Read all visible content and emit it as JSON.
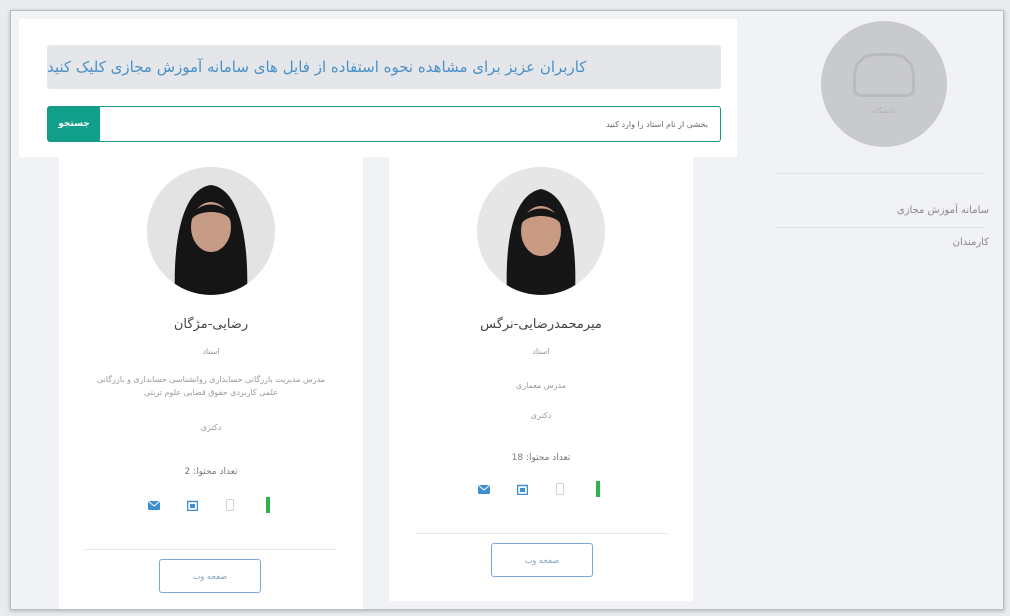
{
  "banner": {
    "text": "کاربران عزیز برای مشاهده نحوه استفاده از فایل های سامانه آموزش مجازی کلیک کنید"
  },
  "search": {
    "button_label": "جستجو",
    "placeholder": "بخشی از نام استاد را وارد کنید"
  },
  "sidebar": {
    "logo_text": "دانشگاه",
    "items": [
      {
        "label": "سامانه آموزش مجازی"
      },
      {
        "label": "کارمندان"
      }
    ]
  },
  "cards": [
    {
      "name": "میرمحمدرضایی-نرگس",
      "role": "استاد",
      "description": "مدرس معماری",
      "degree": "دکتری",
      "count_label": "تعداد محتوا: 18",
      "web_button": "صفحه وب"
    },
    {
      "name": "رضایی-مژگان",
      "role": "استاد",
      "description": "مدرس مدیریت بازرگانی حسابداری روانشناسی حسابداری و بازرگانی علمی کاربردی حقوق قضایی علوم تربتی",
      "degree": "دکتری",
      "count_label": "تعداد محتوا: 2",
      "web_button": "صفحه وب"
    }
  ],
  "colors": {
    "accent": "#119e8a",
    "banner_text": "#4a90c8",
    "icon_blue": "#3f8fd0",
    "icon_green": "#2fb24a"
  },
  "icons": [
    "email-icon",
    "calendar-icon",
    "phone-icon",
    "status-icon"
  ]
}
